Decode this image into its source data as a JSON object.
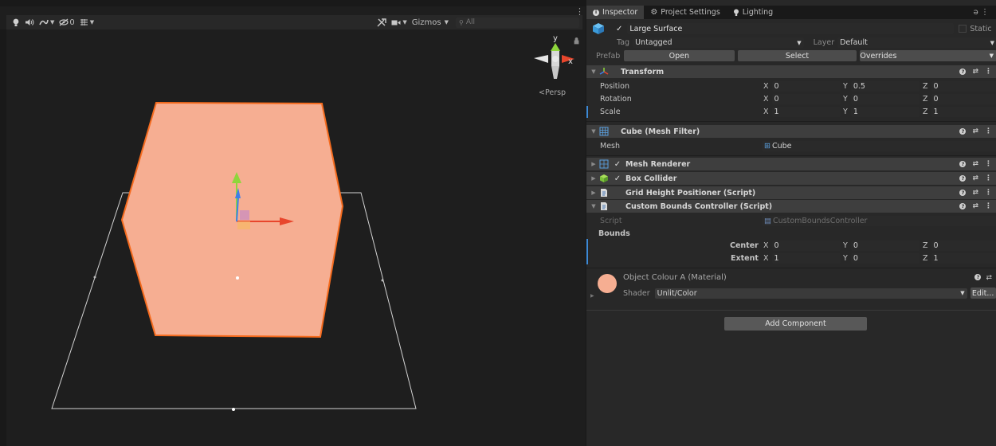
{
  "scene": {
    "toolbar": {
      "badge_count": "0",
      "gizmos_label": "Gizmos",
      "search_placeholder": "All"
    },
    "persp_label": "<Persp",
    "gizmo_axes": {
      "y": "y",
      "x": "x"
    },
    "colors": {
      "cube_fill": "#f6ae92",
      "cube_outline": "#f56b1e",
      "bounds_outline": "#ffffff",
      "axis_x": "#e8462c",
      "axis_y": "#8fd63c",
      "axis_z": "#3f7fe8"
    }
  },
  "inspector": {
    "tabs": [
      {
        "label": "Inspector",
        "icon": "info-icon"
      },
      {
        "label": "Project Settings",
        "icon": "gear-icon"
      },
      {
        "label": "Lighting",
        "icon": "bulb-icon"
      }
    ],
    "object": {
      "name": "Large Surface",
      "static_label": "Static",
      "tag_label": "Tag",
      "tag_value": "Untagged",
      "layer_label": "Layer",
      "layer_value": "Default"
    },
    "prefab": {
      "label": "Prefab",
      "open": "Open",
      "select": "Select",
      "overrides": "Overrides"
    },
    "transform": {
      "title": "Transform",
      "position": {
        "label": "Position",
        "x": "0",
        "y": "0.5",
        "z": "0"
      },
      "rotation": {
        "label": "Rotation",
        "x": "0",
        "y": "0",
        "z": "0"
      },
      "scale": {
        "label": "Scale",
        "x": "1",
        "y": "1",
        "z": "1"
      }
    },
    "mesh_filter": {
      "title": "Cube (Mesh Filter)",
      "mesh_label": "Mesh",
      "mesh_value": "Cube"
    },
    "components": [
      {
        "title": "Mesh Renderer"
      },
      {
        "title": "Box Collider"
      },
      {
        "title": "Grid Height Positioner (Script)"
      }
    ],
    "custom_bounds": {
      "title": "Custom Bounds Controller (Script)",
      "script_label": "Script",
      "script_value": "CustomBoundsController",
      "bounds_label": "Bounds",
      "center": {
        "label": "Center",
        "x": "0",
        "y": "0",
        "z": "0"
      },
      "extent": {
        "label": "Extent",
        "x": "1",
        "y": "0",
        "z": "1"
      }
    },
    "material": {
      "name": "Object Colour A (Material)",
      "shader_label": "Shader",
      "shader_value": "Unlit/Color",
      "edit_label": "Edit...",
      "swatch_color": "#f6ae92"
    },
    "add_component": "Add Component",
    "axis_labels": {
      "x": "X",
      "y": "Y",
      "z": "Z"
    }
  }
}
